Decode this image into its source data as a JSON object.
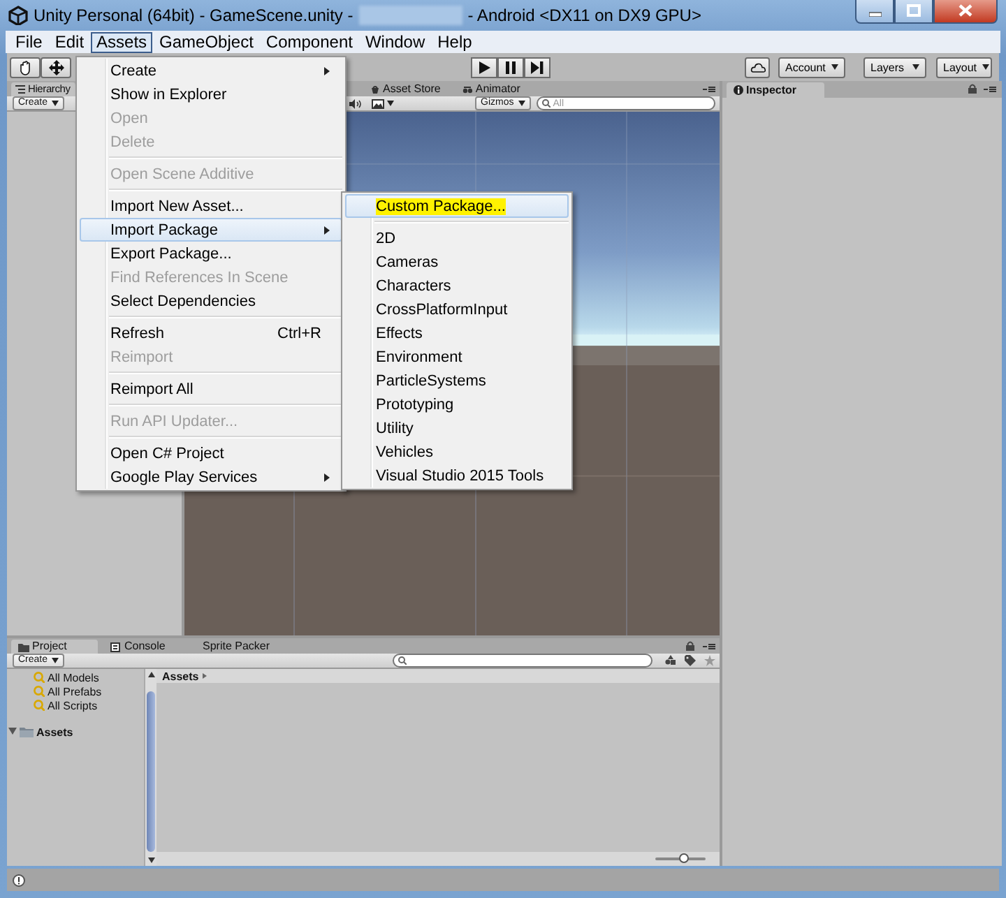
{
  "window": {
    "title": "Unity Personal (64bit) - GameScene.unity -",
    "title_suffix": "- Android <DX11 on DX9 GPU>"
  },
  "menu_bar": [
    {
      "label": "File",
      "selected": false
    },
    {
      "label": "Edit",
      "selected": false
    },
    {
      "label": "Assets",
      "selected": true
    },
    {
      "label": "GameObject",
      "selected": false
    },
    {
      "label": "Component",
      "selected": false
    },
    {
      "label": "Window",
      "selected": false
    },
    {
      "label": "Help",
      "selected": false
    }
  ],
  "toolbar": {
    "dropdowns": [
      "Account",
      "Layers",
      "Layout"
    ]
  },
  "hierarchy": {
    "tab": "Hierarchy",
    "create": "Create"
  },
  "scene": {
    "tabs": [
      "Asset Store",
      "Animator"
    ],
    "gizmos": "Gizmos",
    "search_placeholder": "All"
  },
  "inspector": {
    "tab": "Inspector"
  },
  "project": {
    "tabs": [
      {
        "label": "Project",
        "selected": true
      },
      {
        "label": "Console",
        "selected": false
      },
      {
        "label": "Sprite Packer",
        "selected": false
      }
    ],
    "create": "Create",
    "favorites": [
      "All Models",
      "All Prefabs",
      "All Scripts"
    ],
    "tree": [
      {
        "label": "Assets",
        "expanded": true
      }
    ],
    "breadcrumb": "Assets",
    "zoom": {
      "level": 0.55
    }
  },
  "assets_menu": {
    "items": [
      {
        "kind": "item",
        "label": "Create",
        "disabled": false,
        "submenu": true,
        "highlighted": false
      },
      {
        "kind": "item",
        "label": "Show in Explorer",
        "disabled": false,
        "submenu": false,
        "highlighted": false
      },
      {
        "kind": "item",
        "label": "Open",
        "disabled": true,
        "submenu": false,
        "highlighted": false
      },
      {
        "kind": "item",
        "label": "Delete",
        "disabled": true,
        "submenu": false,
        "highlighted": false
      },
      {
        "kind": "separator"
      },
      {
        "kind": "item",
        "label": "Open Scene Additive",
        "disabled": true,
        "submenu": false,
        "highlighted": false
      },
      {
        "kind": "separator"
      },
      {
        "kind": "item",
        "label": "Import New Asset...",
        "disabled": false,
        "submenu": false,
        "highlighted": false
      },
      {
        "kind": "item",
        "label": "Import Package",
        "disabled": false,
        "submenu": true,
        "highlighted": true
      },
      {
        "kind": "item",
        "label": "Export Package...",
        "disabled": false,
        "submenu": false,
        "highlighted": false
      },
      {
        "kind": "item",
        "label": "Find References In Scene",
        "disabled": true,
        "submenu": false,
        "highlighted": false
      },
      {
        "kind": "item",
        "label": "Select Dependencies",
        "disabled": false,
        "submenu": false,
        "highlighted": false
      },
      {
        "kind": "separator"
      },
      {
        "kind": "item",
        "label": "Refresh",
        "shortcut": "Ctrl+R",
        "disabled": false,
        "submenu": false,
        "highlighted": false
      },
      {
        "kind": "item",
        "label": "Reimport",
        "disabled": true,
        "submenu": false,
        "highlighted": false
      },
      {
        "kind": "separator"
      },
      {
        "kind": "item",
        "label": "Reimport All",
        "disabled": false,
        "submenu": false,
        "highlighted": false
      },
      {
        "kind": "separator"
      },
      {
        "kind": "item",
        "label": "Run API Updater...",
        "disabled": true,
        "submenu": false,
        "highlighted": false
      },
      {
        "kind": "separator"
      },
      {
        "kind": "item",
        "label": "Open C# Project",
        "disabled": false,
        "submenu": false,
        "highlighted": false
      },
      {
        "kind": "item",
        "label": "Google Play Services",
        "disabled": false,
        "submenu": true,
        "highlighted": false
      }
    ]
  },
  "import_package_menu": {
    "items": [
      {
        "kind": "item",
        "label": "Custom Package...",
        "highlighted": true,
        "marked": true
      },
      {
        "kind": "separator"
      },
      {
        "kind": "item",
        "label": "2D",
        "highlighted": false,
        "marked": false
      },
      {
        "kind": "item",
        "label": "Cameras",
        "highlighted": false,
        "marked": false
      },
      {
        "kind": "item",
        "label": "Characters",
        "highlighted": false,
        "marked": false
      },
      {
        "kind": "item",
        "label": "CrossPlatformInput",
        "highlighted": false,
        "marked": false
      },
      {
        "kind": "item",
        "label": "Effects",
        "highlighted": false,
        "marked": false
      },
      {
        "kind": "item",
        "label": "Environment",
        "highlighted": false,
        "marked": false
      },
      {
        "kind": "item",
        "label": "ParticleSystems",
        "highlighted": false,
        "marked": false
      },
      {
        "kind": "item",
        "label": "Prototyping",
        "highlighted": false,
        "marked": false
      },
      {
        "kind": "item",
        "label": "Utility",
        "highlighted": false,
        "marked": false
      },
      {
        "kind": "item",
        "label": "Vehicles",
        "highlighted": false,
        "marked": false
      },
      {
        "kind": "item",
        "label": "Visual Studio 2015 Tools",
        "highlighted": false,
        "marked": false
      }
    ]
  }
}
